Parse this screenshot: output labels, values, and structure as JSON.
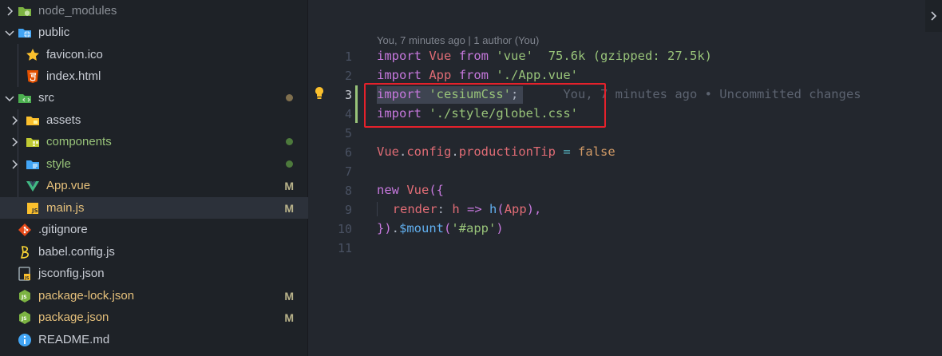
{
  "explorer": {
    "items": [
      {
        "label": "node_modules",
        "color": "#8b9097"
      },
      {
        "label": "public",
        "color": "#c8ccd4"
      },
      {
        "label": "favicon.ico",
        "color": "#c8ccd4"
      },
      {
        "label": "index.html",
        "color": "#c8ccd4"
      },
      {
        "label": "src",
        "color": "#c8ccd4"
      },
      {
        "label": "assets",
        "color": "#c8ccd4"
      },
      {
        "label": "components",
        "color": "#98c379"
      },
      {
        "label": "style",
        "color": "#98c379"
      },
      {
        "label": "App.vue",
        "color": "#e5c07b",
        "badge": "M"
      },
      {
        "label": "main.js",
        "color": "#e5c07b",
        "badge": "M"
      },
      {
        "label": ".gitignore",
        "color": "#c8ccd4"
      },
      {
        "label": "babel.config.js",
        "color": "#c8ccd4"
      },
      {
        "label": "jsconfig.json",
        "color": "#c8ccd4"
      },
      {
        "label": "package-lock.json",
        "color": "#e5c07b",
        "badge": "M"
      },
      {
        "label": "package.json",
        "color": "#e5c07b",
        "badge": "M"
      },
      {
        "label": "README.md",
        "color": "#c8ccd4"
      }
    ]
  },
  "editor": {
    "codelens": "You, 7 minutes ago | 1 author (You)",
    "line_numbers": [
      "1",
      "2",
      "3",
      "4",
      "5",
      "6",
      "7",
      "8",
      "9",
      "10",
      "11"
    ],
    "lines": {
      "l1": {
        "k1": "import",
        "v": "Vue",
        "k2": "from",
        "s": "'vue'",
        "size": "75.6k (gzipped: 27.5k)"
      },
      "l2": {
        "k1": "import",
        "v": "App",
        "k2": "from",
        "s": "'./App.vue'"
      },
      "l3": {
        "k1": "import",
        "s": "'cesiumCss'",
        "p": ";",
        "blame": "You, 7 minutes ago • Uncommitted changes"
      },
      "l4": {
        "k1": "import",
        "s": "'./style/globel.css'"
      },
      "l6": {
        "obj": "Vue",
        "dot1": ".",
        "config": "config",
        "dot2": ".",
        "prop": "productionTip",
        "eq": " = ",
        "val": "false"
      },
      "l8": {
        "k": "new",
        "cls": "Vue",
        "open": "({"
      },
      "l9": {
        "key": "render",
        "colon": ": ",
        "param": "h",
        "arrow": " => ",
        "call": "h",
        "lp": "(",
        "arg": "App",
        "rp": "),"
      },
      "l10": {
        "close": "})",
        "dot": ".",
        "mount": "$mount",
        "lp": "(",
        "s": "'#app'",
        "rp": ")"
      }
    }
  },
  "colors": {
    "accent": "#e5212b",
    "modified": "#e5c07b",
    "untracked": "#98c379"
  }
}
